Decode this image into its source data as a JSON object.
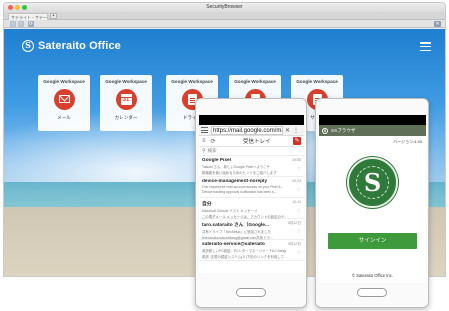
{
  "window": {
    "title": "SecurityBrowser"
  },
  "tabs": [
    {
      "label": "サテライト・サテー..."
    }
  ],
  "tab_add": "+",
  "toolbar": {
    "back": "‹",
    "forward": "›",
    "reload": "⟳",
    "right": "✕"
  },
  "page": {
    "brand": {
      "mark": "S",
      "name": "Sateraito Office"
    },
    "apps": [
      {
        "header": "Google Workspace",
        "label": "メール",
        "icon": "mail-icon"
      },
      {
        "header": "Google Workspace",
        "label": "カレンダー",
        "icon": "calendar-icon",
        "icon_text": "31"
      },
      {
        "header": "Google Workspace",
        "label": "ドライブ",
        "icon": "docs-icon"
      },
      {
        "header": "Google Workspace",
        "label": "",
        "icon": "docs-icon"
      },
      {
        "header": "Google Workspace",
        "label": "サイト",
        "icon": "docs-icon"
      }
    ]
  },
  "phone_mail": {
    "url": "https://mail.google.com/mail/",
    "url_close": "✕",
    "url_more": "⋮",
    "inbox_title": "受信トレイ",
    "search_placeholder": "検索",
    "messages": [
      {
        "from": "Google Pixel",
        "time": "10:55",
        "line1": "Tatsuki さん、新しいGoogle Pixelへようこそ",
        "line2": "新機能を使い始めるためのヒントをご紹介します"
      },
      {
        "from": "device-management-noreply",
        "time": "10:24",
        "line1": "One request for mail account access on your Pixel 6...",
        "line2": "Device tracking approval notification has been s..."
      },
      {
        "from": "自分",
        "time": "10:11",
        "line1": "Microsoft Outlook テスト メッセージ",
        "line2": "この電子メール メッセージは、アカウントの設定のテ..."
      },
      {
        "from": "taro.satoraito さん（Google...",
        "time": "4月12日",
        "line1": "共有ドライブ「SecSetup」に追加されました",
        "line2": "test.tanaka.satoraitoorg@gmail.com共有ドラ..."
      },
      {
        "from": "sateraito-service@sateraito",
        "time": "4月12日",
        "line1": "英訳新しいPC認証：PCレターマネージャー Fin Change...",
        "line2": "英訳 :正規の認証システム(人)下記のリンクを利用して..."
      }
    ]
  },
  "phone_login": {
    "app_title": "SSブラウザ",
    "version": "バージョン:4.93",
    "emblem_letter": "S",
    "signin": "サインイン",
    "copyright": "© Sateraito Office Inc."
  },
  "colors": {
    "accent_red": "#d93f2d",
    "signin_green": "#3e9a3b",
    "emblem_green": "#2f7a3a"
  }
}
